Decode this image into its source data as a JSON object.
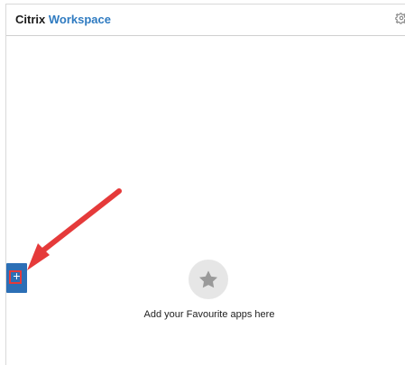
{
  "header": {
    "brand_primary": "Citrix",
    "brand_accent": "Workspace",
    "settings_icon": "gear-icon"
  },
  "sidebar": {
    "add_icon": "plus-icon",
    "add_label": "+"
  },
  "main": {
    "empty_state_icon": "star-icon",
    "empty_state_text": "Add your Favourite apps here"
  },
  "annotation": {
    "arrow_color": "#e53a3a"
  }
}
